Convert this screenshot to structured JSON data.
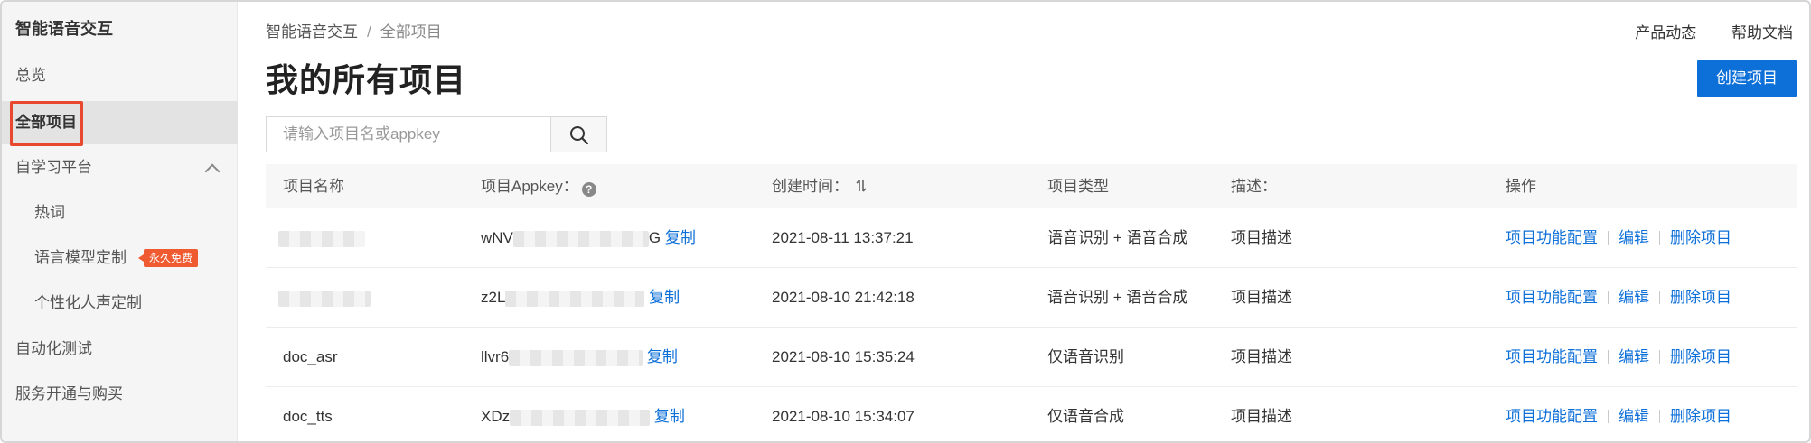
{
  "sidebar": {
    "title": "智能语音交互",
    "items": [
      {
        "label": "总览"
      },
      {
        "label": "全部项目"
      },
      {
        "label": "自学习平台"
      },
      {
        "label": "热词"
      },
      {
        "label": "语言模型定制",
        "badge": "永久免费"
      },
      {
        "label": "个性化人声定制"
      },
      {
        "label": "自动化测试"
      },
      {
        "label": "服务开通与购买"
      }
    ]
  },
  "header": {
    "breadcrumb": {
      "root": "智能语音交互",
      "separator": "/",
      "current": "全部项目"
    },
    "links": {
      "product_news": "产品动态",
      "help_docs": "帮助文档"
    },
    "page_title": "我的所有项目",
    "create_button": "创建项目"
  },
  "search": {
    "placeholder": "请输入项目名或appkey",
    "value": "",
    "icon": "search-icon"
  },
  "table": {
    "columns": {
      "name": "项目名称",
      "appkey": "项目Appkey：",
      "created": "创建时间：",
      "type": "项目类型",
      "desc": "描述：",
      "ops": "操作"
    },
    "rows": [
      {
        "name_visible": "",
        "appkey_prefix": "wNV",
        "appkey_suffix": "G",
        "copy": "复制",
        "created": "2021-08-11 13:37:21",
        "type": "语音识别 + 语音合成",
        "desc": "项目描述"
      },
      {
        "name_visible": "",
        "appkey_prefix": "z2L",
        "appkey_suffix": "",
        "copy": "复制",
        "created": "2021-08-10 21:42:18",
        "type": "语音识别 + 语音合成",
        "desc": "项目描述"
      },
      {
        "name_visible": "doc_asr",
        "appkey_prefix": "llvr6",
        "appkey_suffix": "",
        "copy": "复制",
        "created": "2021-08-10 15:35:24",
        "type": "仅语音识别",
        "desc": "项目描述"
      },
      {
        "name_visible": "doc_tts",
        "appkey_prefix": "XDz",
        "appkey_suffix": "",
        "copy": "复制",
        "created": "2021-08-10 15:34:07",
        "type": "仅语音合成",
        "desc": "项目描述"
      }
    ],
    "operations": {
      "config": "项目功能配置",
      "edit": "编辑",
      "delete": "删除项目"
    }
  },
  "colors": {
    "accent": "#0d6fd8",
    "highlight_border": "#e8492e",
    "badge": "#ef5a30"
  }
}
